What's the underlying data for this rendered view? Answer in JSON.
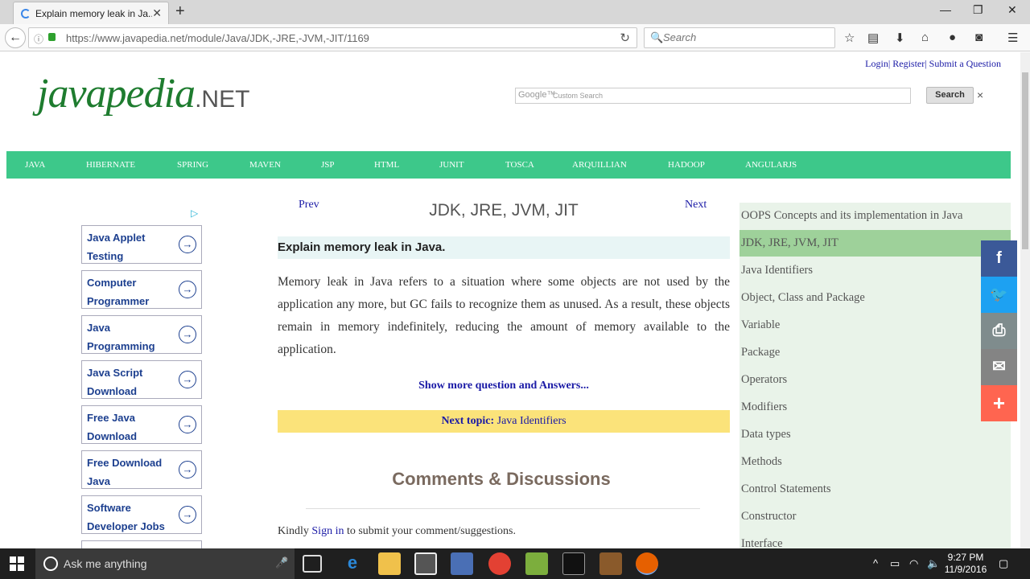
{
  "browser": {
    "tab_title": "Explain memory leak in Ja...",
    "url": "https://www.javapedia.net/module/Java/JDK,-JRE,-JVM,-JIT/1169",
    "search_placeholder": "Search"
  },
  "header": {
    "top_links": [
      "Login",
      "Register",
      "Submit a Question"
    ],
    "logo_main": "javapedia",
    "logo_suffix": ".NET",
    "google_label": "Google™",
    "google_placeholder": "Custom Search",
    "search_button": "Search",
    "clear_symbol": "×"
  },
  "menu": [
    "JAVA",
    "HIBERNATE",
    "SPRING",
    "MAVEN",
    "JSP",
    "HTML",
    "JUNIT",
    "TOSCA",
    "ARQUILLIAN",
    "HADOOP",
    "ANGULARJS"
  ],
  "ads": [
    "Java Applet Testing",
    "Computer Programmer",
    "Java Programming",
    "Java Script Download",
    "Free Java Download",
    "Free Download Java",
    "Software Developer Jobs"
  ],
  "content": {
    "prev": "Prev",
    "next": "Next",
    "page_title": "JDK, JRE, JVM, JIT",
    "question": "Explain memory leak in Java.",
    "answer": "Memory leak in Java refers to a situation where some objects are not used by the application any more, but GC fails to recognize them as unused. As a result, these objects remain in memory indefinitely, reducing the amount of memory available to the application.",
    "show_more": "Show more question and Answers...",
    "next_topic_label": "Next topic:",
    "next_topic_link": "Java Identifiers",
    "comments_heading": "Comments & Discussions",
    "kindly_pre": "Kindly",
    "sign_in": "Sign in",
    "kindly_post": "to submit your comment/suggestions."
  },
  "sidebar": {
    "items": [
      "OOPS Concepts and its implementation in Java",
      "JDK, JRE, JVM, JIT",
      "Java Identifiers",
      "Object, Class and Package",
      "Variable",
      "Package",
      "Operators",
      "Modifiers",
      "Data types",
      "Methods",
      "Control Statements",
      "Constructor",
      "Interface"
    ],
    "active_index": 1
  },
  "share": [
    {
      "icon": "facebook-icon",
      "glyph": "f",
      "color": "#3b5998"
    },
    {
      "icon": "twitter-icon",
      "glyph": "🐦",
      "color": "#1da1f2"
    },
    {
      "icon": "print-icon",
      "glyph": "⎙",
      "color": "#7f8c8d"
    },
    {
      "icon": "email-icon",
      "glyph": "✉",
      "color": "#848484"
    },
    {
      "icon": "plus-icon",
      "glyph": "+",
      "color": "#ff6550"
    }
  ],
  "taskbar": {
    "cortana_placeholder": "Ask me anything",
    "time": "9:27 PM",
    "date": "11/9/2016"
  }
}
